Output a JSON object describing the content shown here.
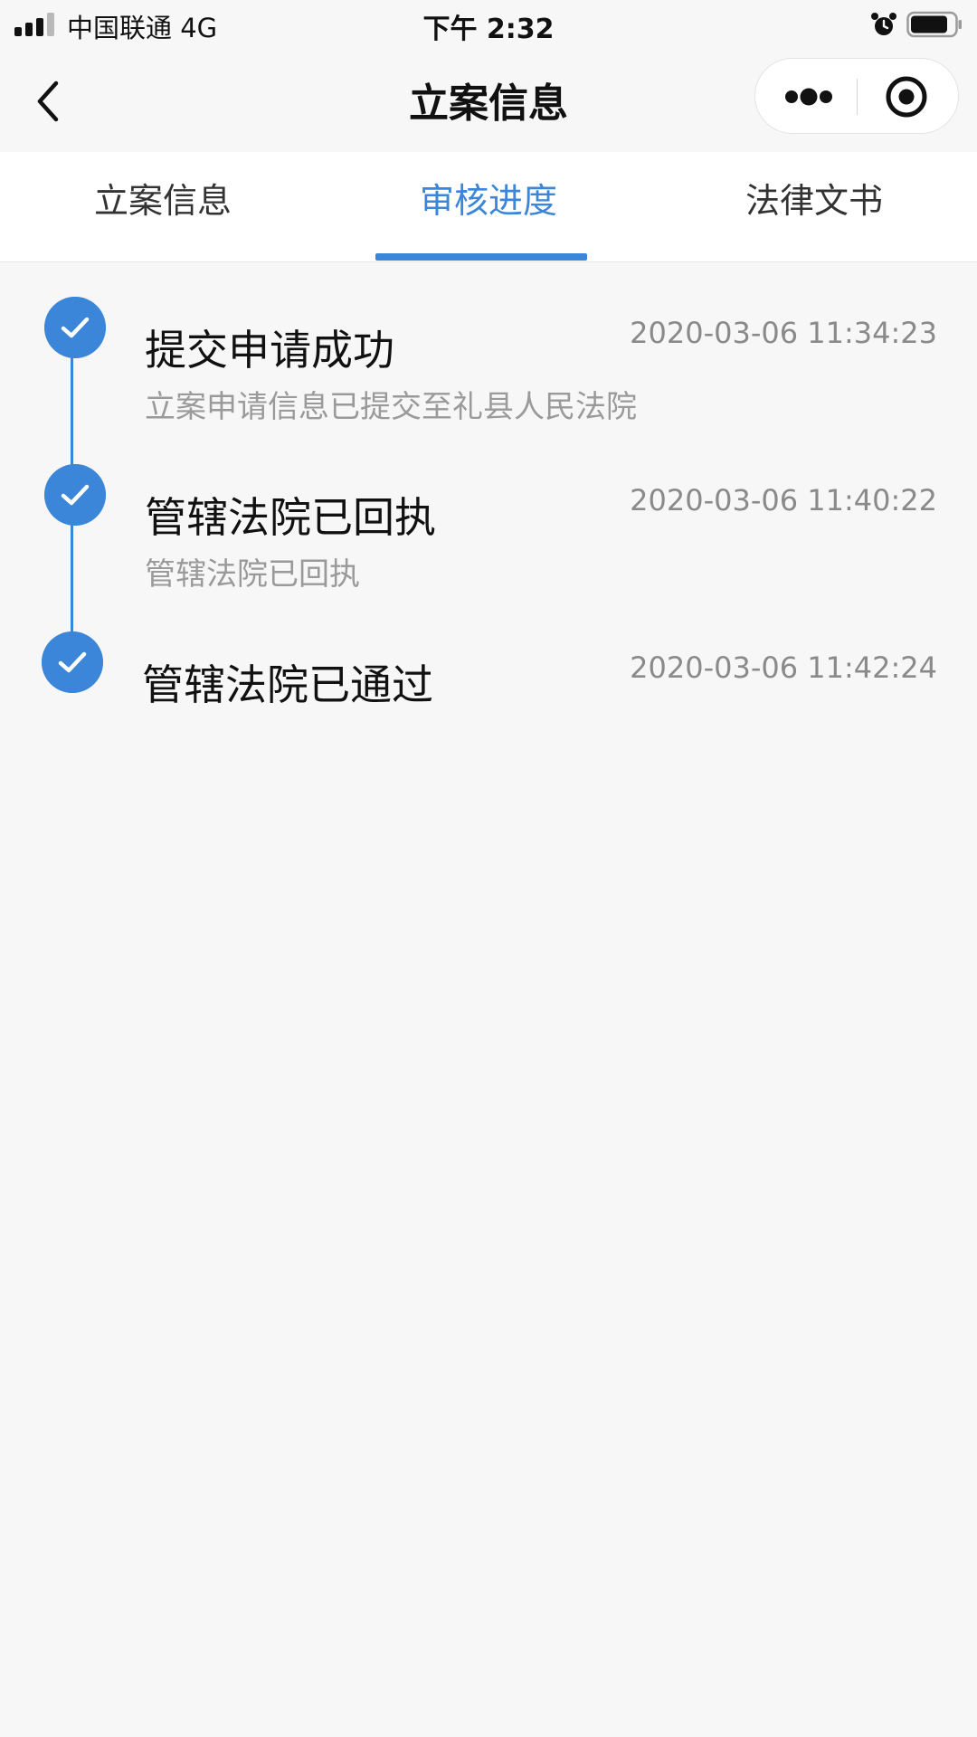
{
  "status_bar": {
    "carrier": "中国联通  4G",
    "time": "下午 2:32"
  },
  "nav": {
    "title": "立案信息",
    "icons": {
      "back": "chevron-left-icon",
      "more": "more-dots-icon",
      "close": "target-circle-icon"
    }
  },
  "tabs": [
    {
      "label": "立案信息",
      "active": false
    },
    {
      "label": "审核进度",
      "active": true
    },
    {
      "label": "法律文书",
      "active": false
    }
  ],
  "timeline": [
    {
      "title": "提交申请成功",
      "time": "2020-03-06 11:34:23",
      "desc": "立案申请信息已提交至礼县人民法院"
    },
    {
      "title": "管辖法院已回执",
      "time": "2020-03-06 11:40:22",
      "desc": "管辖法院已回执"
    },
    {
      "title": "管辖法院已通过",
      "time": "2020-03-06 11:42:24",
      "desc": ""
    }
  ],
  "colors": {
    "accent": "#3b86d9",
    "background": "#f7f7f7"
  }
}
